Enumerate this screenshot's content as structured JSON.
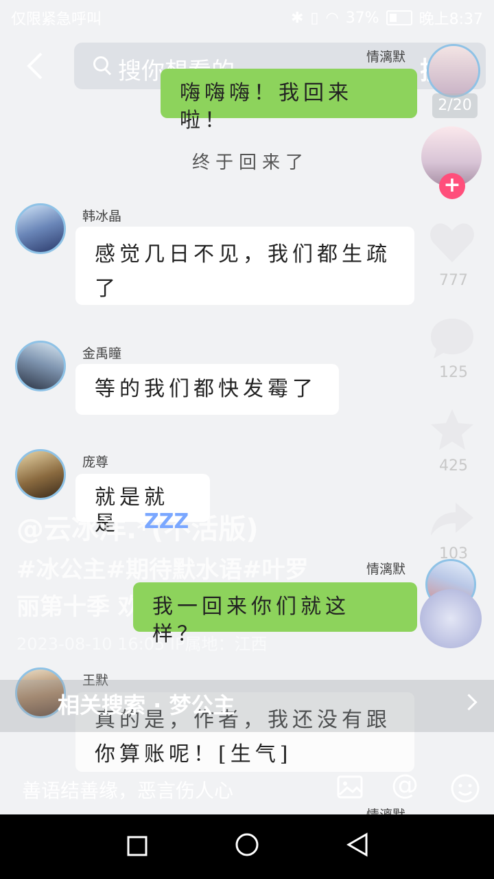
{
  "status_bar": {
    "left_text": "仅限紧急呼叫",
    "battery": "37%",
    "time": "晚上8:37"
  },
  "search": {
    "placeholder": "搜你想看的",
    "button": "搜索"
  },
  "post": {
    "page_indicator": "2/20",
    "likes": "777",
    "comments": "125",
    "favorites": "425",
    "shares": "103",
    "author": "@云冰洋.*(不活版)",
    "tags_line1": "#冰公主#期待默水语#叶罗",
    "tags_line2": "丽第十季  欢迎投稿！  展开",
    "meta": "2023-08-10 16:05  IP属地：江西"
  },
  "chat": {
    "messages": [
      {
        "sender": "情漓默",
        "text": "嗨嗨嗨！我回来啦！",
        "side": "right"
      },
      {
        "sender": "",
        "text": "终于回来了",
        "side": "center"
      },
      {
        "sender": "韩冰晶",
        "text": "感觉几日不见，我们都生疏了",
        "side": "left"
      },
      {
        "sender": "金禹瞳",
        "text": "等的我们都快发霉了",
        "side": "left"
      },
      {
        "sender": "庞尊",
        "text": "就是就是",
        "side": "left"
      },
      {
        "sender": "情漓默",
        "text": "我一回来你们就这样？",
        "side": "right"
      },
      {
        "sender": "王默",
        "text": "真的是，作者，我还没有跟你算账呢！[生气]",
        "side": "left"
      },
      {
        "sender": "情漓默",
        "text": "",
        "side": "right"
      }
    ],
    "msg1_line2": "了",
    "msg7_line1": "真的是，作者，我还没有跟",
    "msg7_line2": "你算账呢！[生气]"
  },
  "related_search": "相关搜索 · 梦公主",
  "comment_bar": {
    "placeholder": "善语结善缘，恶言伤人心"
  },
  "colors": {
    "green_bubble": "#8dd35c",
    "follow_plus": "#ff4f7b"
  }
}
